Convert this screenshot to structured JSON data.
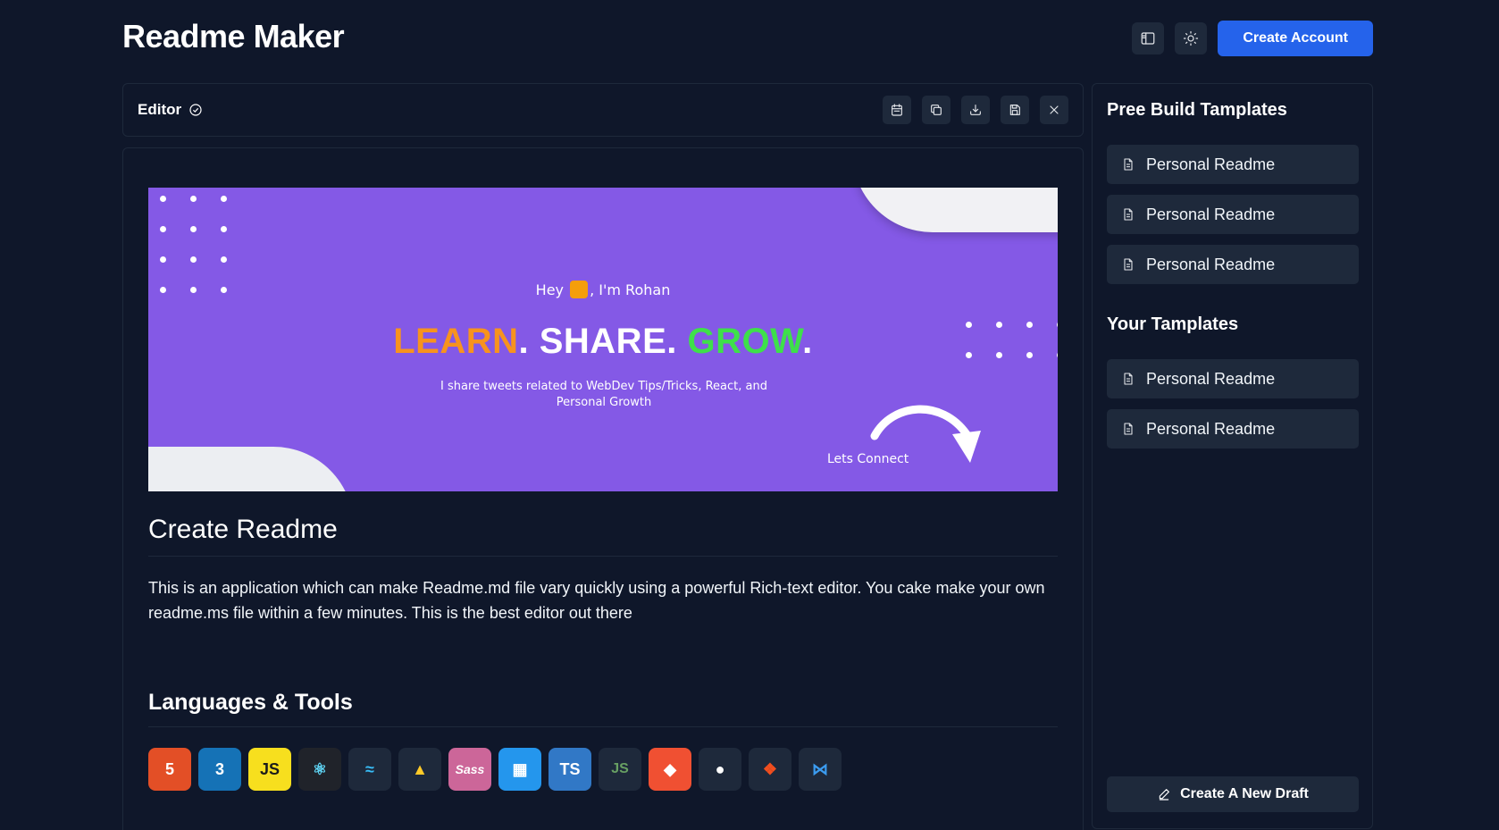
{
  "app": {
    "title": "Readme Maker"
  },
  "header": {
    "layout_icon": "layout-icon",
    "theme_icon": "sun-icon",
    "create_account_label": "Create Account"
  },
  "editor_bar": {
    "label": "Editor",
    "status_icon": "check-circle-icon",
    "tools": [
      "calendar-icon",
      "copy-icon",
      "download-icon",
      "save-icon",
      "close-icon"
    ]
  },
  "banner": {
    "greeting_before": "Hey",
    "greeting_after": ", I'm Rohan",
    "headline_learn": "LEARN",
    "headline_share": ". SHARE. ",
    "headline_grow": "GROW",
    "headline_dot": ".",
    "subtext": "I share tweets related to WebDev Tips/Tricks, React, and Personal Growth",
    "connect": "Lets Connect",
    "colors": {
      "background": "#8459e6",
      "learn": "#f7931e",
      "grow": "#3ee04a"
    }
  },
  "content": {
    "heading": "Create Readme",
    "paragraph": "This is an application which can make Readme.md file vary quickly using a powerful Rich-text editor. You cake make your own readme.ms file within a few minutes. This is the best editor out there",
    "tools_heading": "Languages & Tools",
    "tools": [
      {
        "name": "html5",
        "glyph": "5",
        "color": "#e34f26"
      },
      {
        "name": "css3",
        "glyph": "3",
        "color": "#1572b6"
      },
      {
        "name": "javascript",
        "glyph": "JS",
        "color": "#f7df1e"
      },
      {
        "name": "react",
        "glyph": "⚛",
        "color": "#20232a"
      },
      {
        "name": "tailwind",
        "glyph": "≈",
        "color": "#1e293b"
      },
      {
        "name": "firebase",
        "glyph": "▲",
        "color": "#1e293b"
      },
      {
        "name": "sass",
        "glyph": "Sass",
        "color": "#cc6699"
      },
      {
        "name": "docker",
        "glyph": "▦",
        "color": "#2496ed"
      },
      {
        "name": "typescript",
        "glyph": "TS",
        "color": "#3178c6"
      },
      {
        "name": "nodejs",
        "glyph": "JS",
        "color": "#1e293b"
      },
      {
        "name": "git",
        "glyph": "◆",
        "color": "#f05032"
      },
      {
        "name": "github",
        "glyph": "●",
        "color": "#1e293b"
      },
      {
        "name": "figma",
        "glyph": "❖",
        "color": "#1e293b"
      },
      {
        "name": "vscode",
        "glyph": "⋈",
        "color": "#1e293b"
      }
    ]
  },
  "sidebar": {
    "prebuilt_heading": "Pree Build Tamplates",
    "prebuilt": [
      "Personal Readme",
      "Personal Readme",
      "Personal Readme"
    ],
    "yours_heading": "Your Tamplates",
    "yours": [
      "Personal Readme",
      "Personal Readme"
    ],
    "draft_label": "Create A New Draft"
  }
}
